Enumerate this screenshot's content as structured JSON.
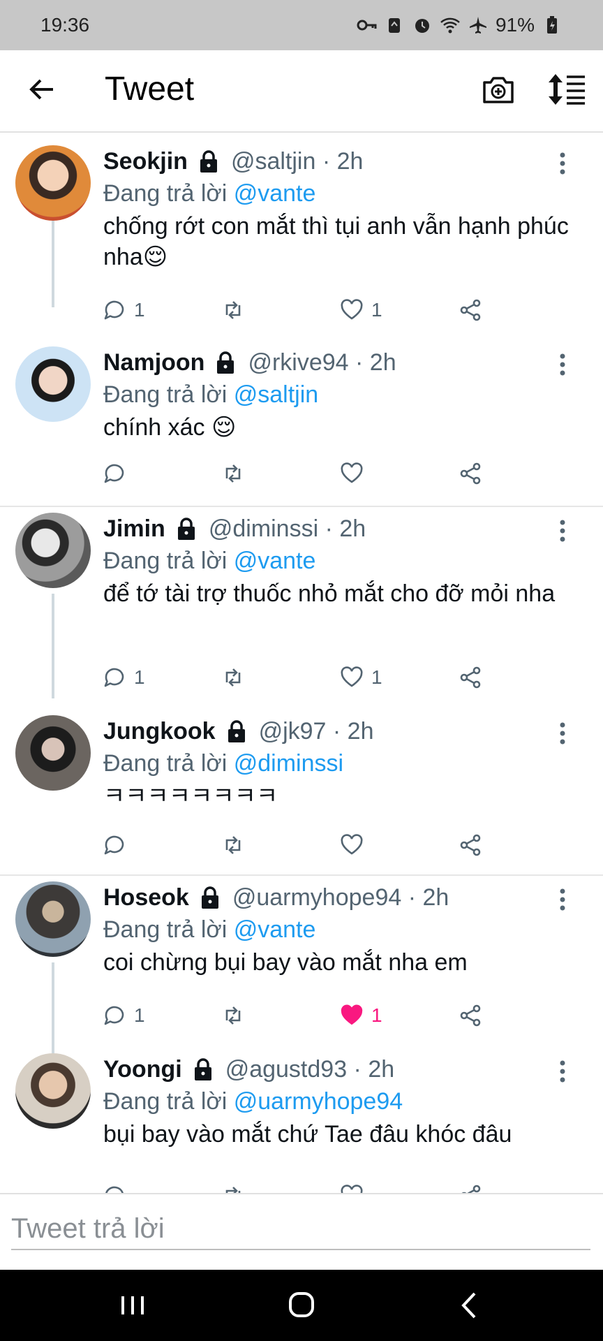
{
  "status_bar": {
    "time": "19:36",
    "battery": "91%"
  },
  "header": {
    "title": "Tweet"
  },
  "tweets": [
    {
      "name": "Seokjin",
      "handle": "@saltjin · 2h",
      "reply_prefix": "Đang trả lời",
      "reply_to": "@vante",
      "text": "chống rớt con mắt thì tụi anh vẫn hạnh phúc nha😌",
      "replies": "1",
      "retweets": "",
      "likes": "1",
      "liked": false
    },
    {
      "name": "Namjoon",
      "handle": "@rkive94 · 2h",
      "reply_prefix": "Đang trả lời",
      "reply_to": "@saltjin",
      "text": "chính xác 😌",
      "replies": "",
      "retweets": "",
      "likes": "",
      "liked": false
    },
    {
      "name": "Jimin",
      "handle": "@diminssi · 2h",
      "reply_prefix": "Đang trả lời",
      "reply_to": "@vante",
      "text": "để tớ tài trợ thuốc nhỏ mắt cho đỡ mỏi nha",
      "replies": "1",
      "retweets": "",
      "likes": "1",
      "liked": false
    },
    {
      "name": "Jungkook",
      "handle": "@jk97 · 2h",
      "reply_prefix": "Đang trả lời",
      "reply_to": "@diminssi",
      "text": "ㅋㅋㅋㅋㅋㅋㅋㅋ",
      "replies": "",
      "retweets": "",
      "likes": "",
      "liked": false
    },
    {
      "name": "Hoseok",
      "handle": "@uarmyhope94 · 2h",
      "reply_prefix": "Đang trả lời",
      "reply_to": "@vante",
      "text": "coi chừng bụi bay vào mắt nha em",
      "replies": "1",
      "retweets": "",
      "likes": "1",
      "liked": true
    },
    {
      "name": "Yoongi",
      "handle": "@agustd93 · 2h",
      "reply_prefix": "Đang trả lời",
      "reply_to": "@uarmyhope94",
      "text": "bụi bay vào mắt chứ Tae đâu khóc đâu",
      "replies": "",
      "retweets": "",
      "likes": "",
      "liked": false
    }
  ],
  "compose": {
    "placeholder": "Tweet trả lời"
  },
  "colors": {
    "accent": "#1d9bf0",
    "like": "#f91880",
    "muted": "#536471",
    "divider": "#e6e6e6"
  },
  "icons": {
    "back": "arrow-left-icon",
    "camera": "camera-plus-icon",
    "sort": "sort-icon",
    "lock": "lock-icon",
    "more": "more-vertical-icon",
    "reply": "reply-icon",
    "retweet": "retweet-icon",
    "like": "heart-icon",
    "share": "share-icon"
  }
}
